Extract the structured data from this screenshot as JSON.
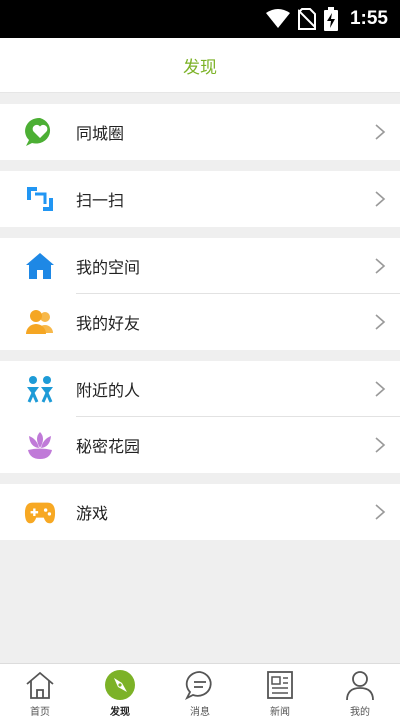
{
  "status": {
    "time": "1:55",
    "icons": [
      "wifi-icon",
      "no-sim-icon",
      "battery-charging-icon"
    ]
  },
  "header": {
    "title": "发现"
  },
  "accent_color": "#7cb227",
  "menu": [
    {
      "label": "同城圈",
      "icon": "chat-heart-icon",
      "color": "#4caf34"
    },
    {
      "label": "扫一扫",
      "icon": "scan-icon",
      "color": "#2196f3"
    },
    {
      "label": "我的空间",
      "icon": "home-icon",
      "color": "#1e88e5"
    },
    {
      "label": "我的好友",
      "icon": "friends-icon",
      "color": "#f5a623"
    },
    {
      "label": "附近的人",
      "icon": "nearby-people-icon",
      "color": "#1e9bd7"
    },
    {
      "label": "秘密花园",
      "icon": "flower-icon",
      "color": "#c07ad8"
    },
    {
      "label": "游戏",
      "icon": "gamepad-icon",
      "color": "#f7a823"
    }
  ],
  "tabs": [
    {
      "label": "首页",
      "icon": "home-outline-icon"
    },
    {
      "label": "发现",
      "icon": "compass-icon",
      "active": true
    },
    {
      "label": "消息",
      "icon": "message-icon"
    },
    {
      "label": "新闻",
      "icon": "news-icon"
    },
    {
      "label": "我的",
      "icon": "person-icon"
    }
  ]
}
